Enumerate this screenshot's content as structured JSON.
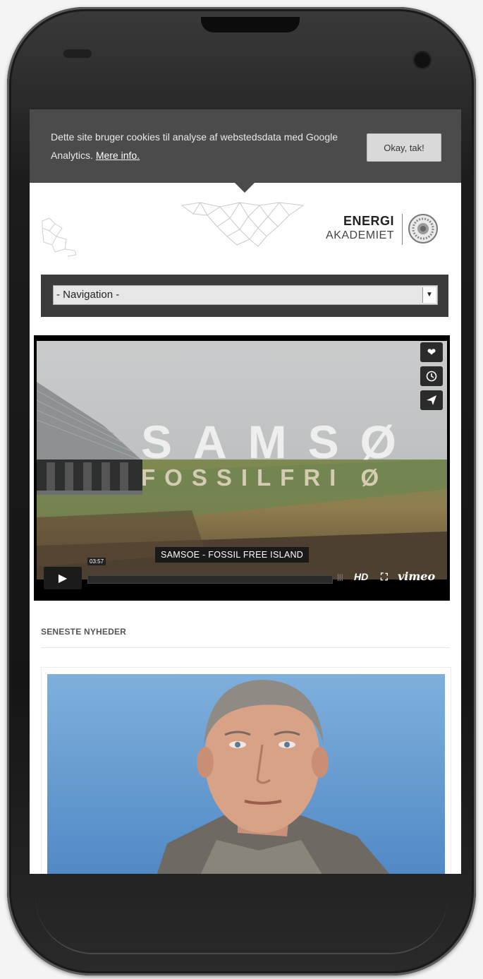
{
  "cookie": {
    "text": "Dette site bruger cookies til analyse af webstedsdata med Google Analytics.",
    "link": "Mere info.",
    "button": "Okay, tak!"
  },
  "logo": {
    "line1": "ENERGI",
    "line2": "AKADEMIET"
  },
  "navigation": {
    "selected": "- Navigation -"
  },
  "video": {
    "title_big": "SAMSØ",
    "title_sub": "FOSSILFRI Ø",
    "caption": "SAMSOE - FOSSIL FREE ISLAND",
    "time": "03:57",
    "hd": "HD",
    "brand": "vimeo",
    "icons": [
      "heart-icon",
      "clock-icon",
      "send-icon"
    ]
  },
  "news": {
    "section_title": "SENESTE NYHEDER"
  },
  "colors": {
    "cookie_bg": "#4b4b4b",
    "nav_bg": "#3b3b3b",
    "phone_body": "#1c1c1c"
  }
}
